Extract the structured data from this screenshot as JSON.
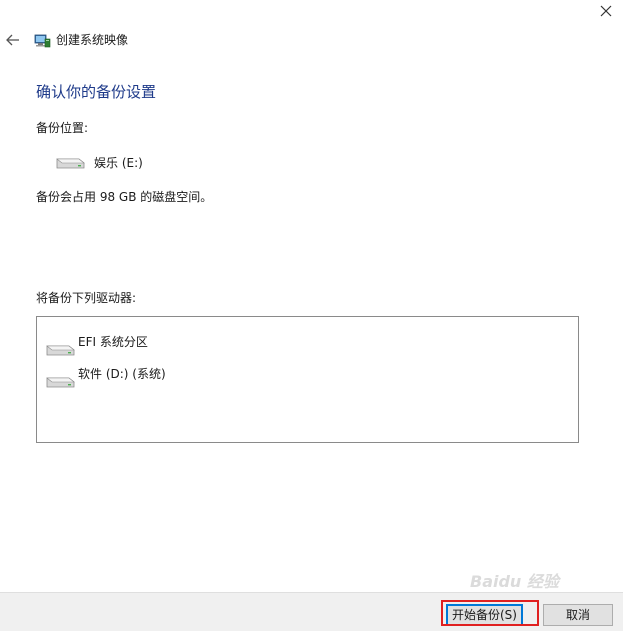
{
  "window": {
    "title": "创建系统映像",
    "close_symbol": "✕"
  },
  "page": {
    "heading": "确认你的备份设置",
    "location_label": "备份位置:",
    "target_drive": {
      "label": "娱乐 (E:)",
      "icon": "hard-drive-icon"
    },
    "space_text": "备份会占用 98 GB 的磁盘空间。",
    "drives_label": "将备份下列驱动器:",
    "drives": [
      {
        "label": "EFI 系统分区",
        "icon": "hard-drive-icon"
      },
      {
        "label": "软件 (D:) (系统)",
        "icon": "hard-drive-icon"
      }
    ]
  },
  "footer": {
    "start_button": "开始备份(S)",
    "cancel_button": "取消"
  },
  "watermark": "Baidu 经验",
  "colors": {
    "heading": "#1e3a8a",
    "footer_bg": "#f0f0f0",
    "highlight": "#e02020",
    "accent": "#0078d7"
  }
}
